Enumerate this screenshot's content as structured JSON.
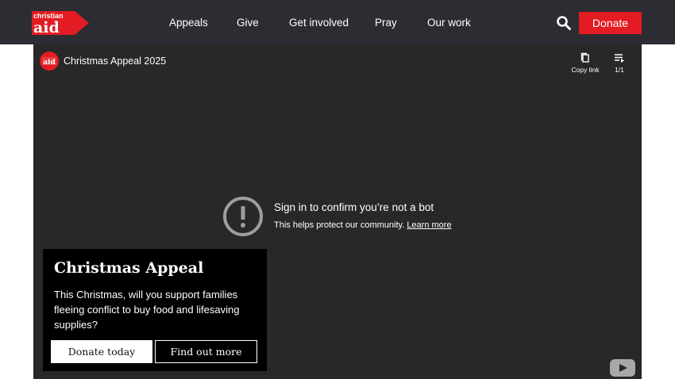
{
  "brand": {
    "logo_line1": "christian",
    "logo_line2": "aid",
    "accent_color": "#e31b23",
    "header_bg": "#2c2d32"
  },
  "nav": {
    "items": [
      "Appeals",
      "Give",
      "Get involved",
      "Pray",
      "Our work"
    ],
    "search_icon": "search-icon",
    "donate_label": "Donate"
  },
  "video": {
    "channel_avatar_text": "aid",
    "title": "Christmas Appeal 2025",
    "copy_link_label": "Copy link",
    "playlist_count": "1/1",
    "bot_title": "Sign in to confirm you’re not a bot",
    "bot_sub": "This helps protect our community.",
    "learn_more": "Learn more",
    "logo_icon": "youtube-logo-icon"
  },
  "promo": {
    "title": "Christmas Appeal",
    "body": "This Christmas, will you support families fleeing conflict to buy food and lifesaving supplies?",
    "primary_btn": "Donate today",
    "secondary_btn": "Find out more"
  }
}
